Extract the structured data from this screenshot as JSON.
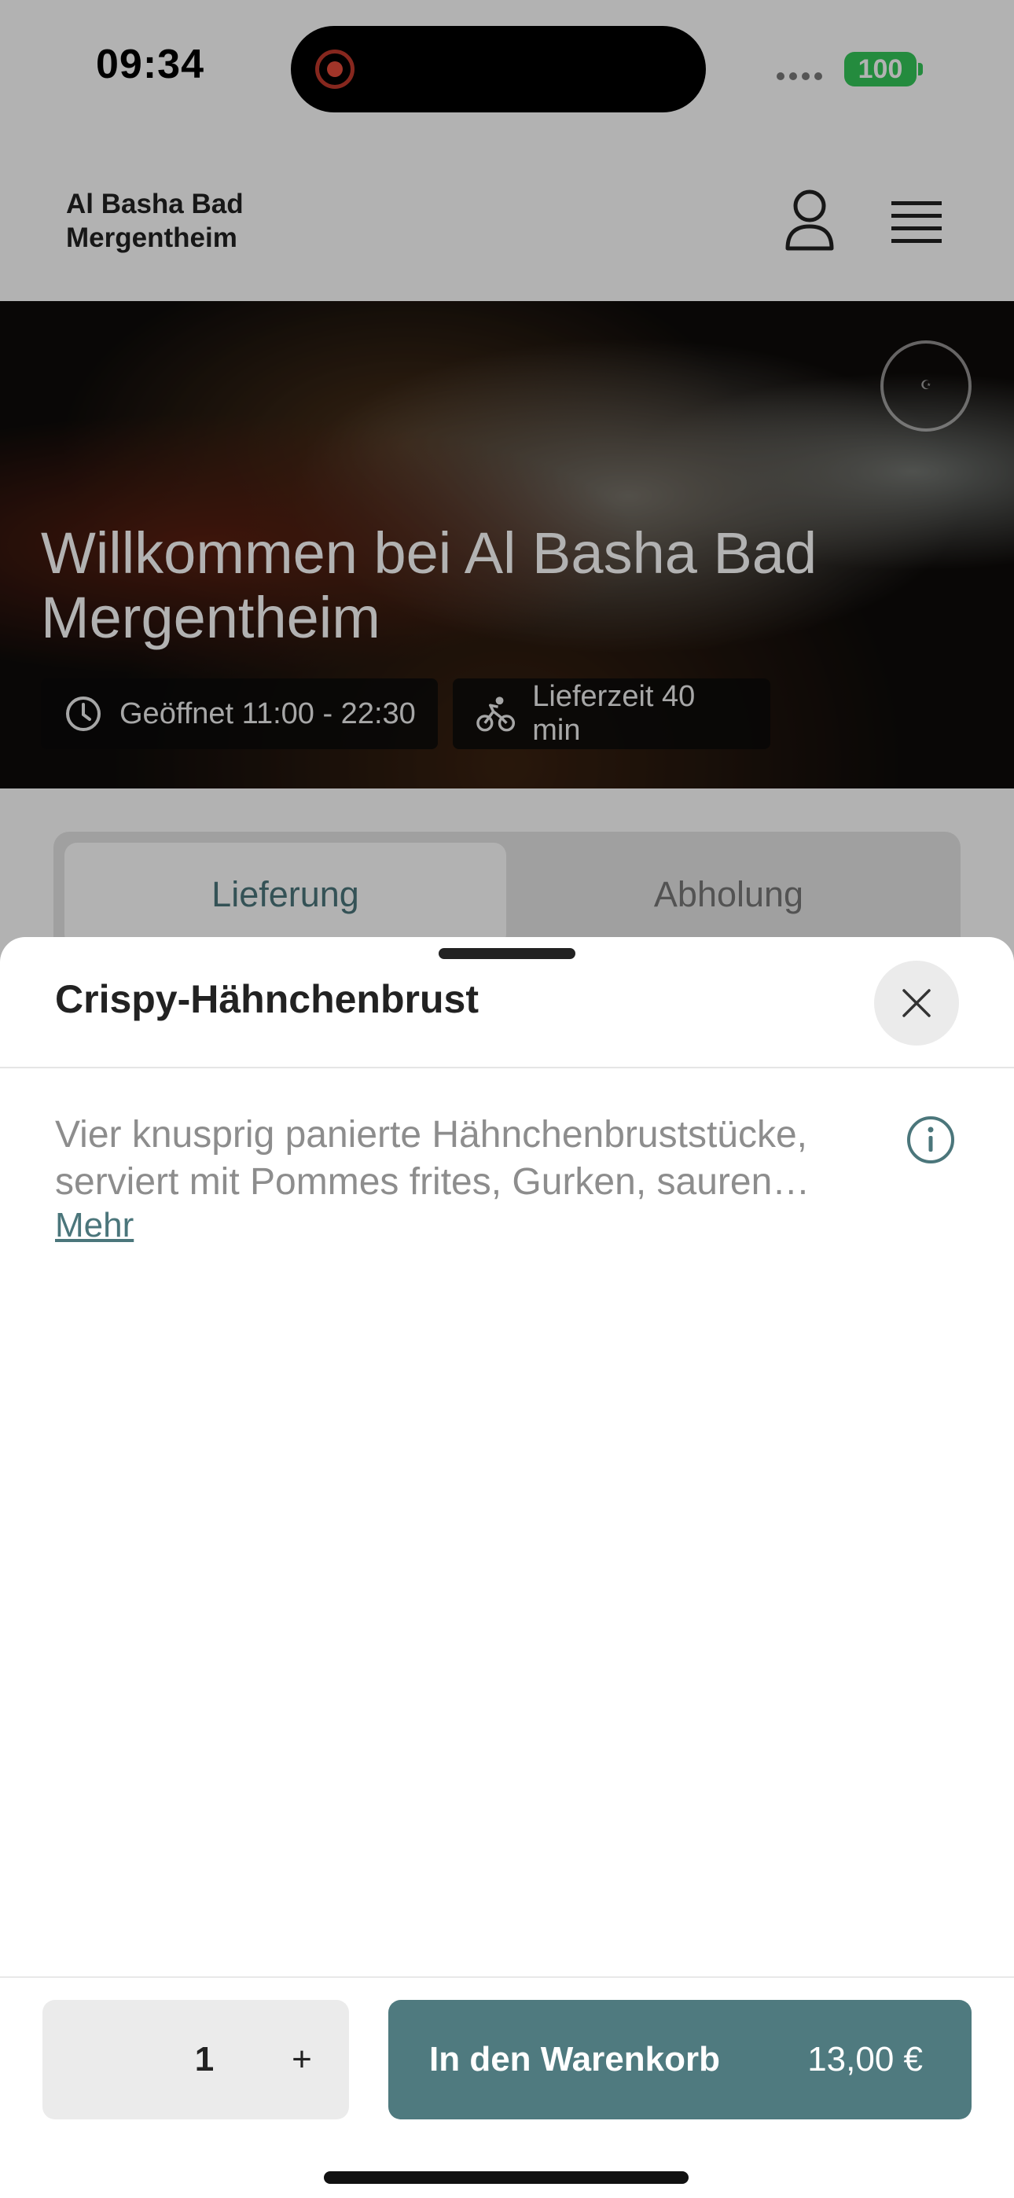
{
  "status_bar": {
    "time": "09:34",
    "battery": "100",
    "battery_color": "#34c759"
  },
  "header": {
    "brand": "Al Basha Bad Mergentheim",
    "icons": [
      "user-icon",
      "menu-icon"
    ]
  },
  "hero": {
    "title": "Willkommen bei Al Basha Bad Mergentheim",
    "opening_hours": "Geöffnet 11:00 - 22:30",
    "delivery_time": "Lieferzeit 40 min",
    "icons": [
      "clock-icon",
      "bicycle-icon",
      "halal-logo"
    ]
  },
  "mode_tabs": [
    {
      "label": "Lieferung",
      "active": true
    },
    {
      "label": "Abholung",
      "active": false
    }
  ],
  "product_sheet": {
    "title": "Crispy-Hähnchenbrust",
    "description": "Vier knusprig panierte Hähnchenbruststücke, serviert mit Pommes frites, Gurken, sauren Gurken und Soße nach Wahl",
    "more_link": "Mehr",
    "quantity": "1",
    "plus_label": "+",
    "add_to_cart_label": "In den Warenkorb",
    "price": "13,00 €",
    "accent_color": "#4f7a7f",
    "icons": [
      "close-icon",
      "info-icon"
    ]
  }
}
